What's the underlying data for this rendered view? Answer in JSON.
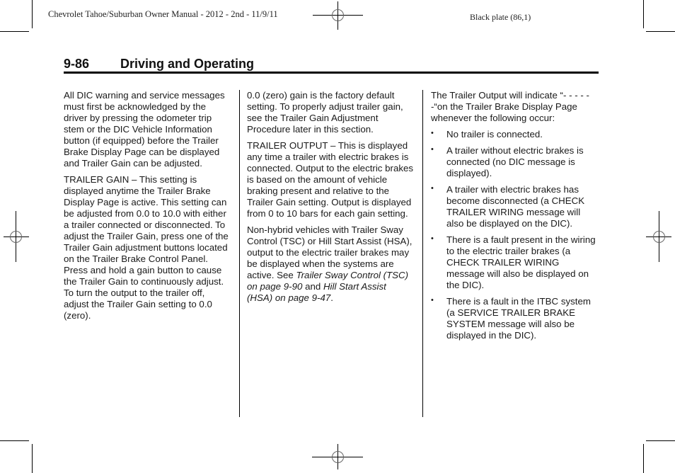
{
  "plate_header": {
    "left": "Chevrolet Tahoe/Suburban Owner Manual - 2012 - 2nd - 11/9/11",
    "right": "Black plate (86,1)"
  },
  "section": {
    "page_number": "9-86",
    "title": "Driving and Operating"
  },
  "columns": {
    "left": {
      "para1": "All DIC warning and service messages must first be acknowledged by the driver by pressing the odometer trip stem or the DIC Vehicle Information button (if equipped) before the Trailer Brake Display Page can be displayed and Trailer Gain can be adjusted.",
      "para2": "TRAILER GAIN – This setting is displayed anytime the Trailer Brake Display Page is active. This setting can be adjusted from 0.0 to 10.0 with either a trailer connected or disconnected. To adjust the Trailer Gain, press one of the Trailer Gain adjustment buttons located on the Trailer Brake Control Panel. Press and hold a gain button to cause the Trailer Gain to continuously adjust. To turn the output to the trailer off, adjust the Trailer Gain setting to 0.0 (zero)."
    },
    "middle": {
      "para1": "0.0 (zero) gain is the factory default setting. To properly adjust trailer gain, see the Trailer Gain Adjustment Procedure later in this section.",
      "para2": "TRAILER OUTPUT – This is displayed any time a trailer with electric brakes is connected. Output to the electric brakes is based on the amount of vehicle braking present and relative to the Trailer Gain setting. Output is displayed from 0 to 10 bars for each gain setting.",
      "para3_text": "Non-hybrid vehicles with Trailer Sway Control (TSC) or Hill Start Assist (HSA), output to the electric trailer brakes may be displayed when the systems are active. See ",
      "para3_link1": "Trailer Sway Control (TSC) on page 9-90",
      "para3_and": " and ",
      "para3_link2": "Hill Start Assist (HSA) on page 9-47",
      "para3_end": "."
    },
    "right": {
      "intro": "The Trailer Output will indicate “- - - - - -“on the Trailer Brake Display Page whenever the following occur:",
      "bullet_glyph": "•",
      "bullets": [
        "No trailer is connected.",
        "A trailer without electric brakes is connected (no DIC message is displayed).",
        "A trailer with electric brakes has become disconnected (a CHECK TRAILER WIRING message will also be displayed on the DIC).",
        "There is a fault present in the wiring to the electric trailer brakes (a CHECK TRAILER WIRING message will also be displayed on the DIC).",
        "There is a fault in the ITBC system (a SERVICE TRAILER BRAKE SYSTEM message will also be displayed in the DIC)."
      ]
    }
  }
}
